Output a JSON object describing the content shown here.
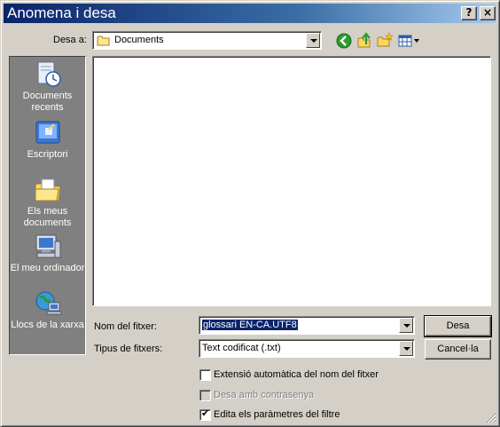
{
  "window": {
    "title": "Anomena i desa",
    "help_label": "?",
    "close_label": "×"
  },
  "toolbar": {
    "save_in_label": "Desa a:",
    "location_value": "Documents",
    "icons": [
      "back-icon",
      "up-folder-icon",
      "new-folder-icon",
      "view-menu-icon"
    ]
  },
  "places": [
    {
      "label": "Documents recents",
      "icon": "recent-documents-icon"
    },
    {
      "label": "Escriptori",
      "icon": "desktop-icon"
    },
    {
      "label": "Els meus documents",
      "icon": "my-documents-icon"
    },
    {
      "label": "El meu ordinador",
      "icon": "my-computer-icon"
    },
    {
      "label": "Llocs de la xarxa",
      "icon": "network-places-icon"
    }
  ],
  "form": {
    "filename_label": "Nom del fitxer:",
    "filename_value": "glossari EN-CA.UTF8",
    "filetype_label": "Tipus de fitxers:",
    "filetype_value": "Text codificat (.txt)"
  },
  "buttons": {
    "save": "Desa",
    "cancel": "Cancel·la"
  },
  "options": [
    {
      "label": "Extensió automàtica del nom del fitxer",
      "checked": false,
      "enabled": true
    },
    {
      "label": "Desa amb contrasenya",
      "checked": false,
      "enabled": false
    },
    {
      "label": "Edita els paràmetres del filtre",
      "checked": true,
      "enabled": true
    }
  ],
  "colors": {
    "title_gradient_start": "#0a246a",
    "title_gradient_end": "#a6caf0",
    "dialog_face": "#d4d0c8",
    "places_bar": "#808080"
  }
}
